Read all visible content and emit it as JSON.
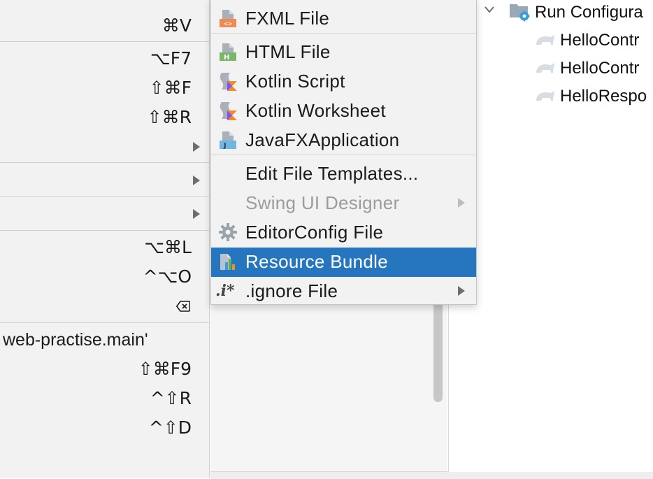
{
  "parent_menu": {
    "rows": [
      {
        "shortcut": "⌘V"
      },
      {
        "shortcut": "⌥F7"
      },
      {
        "shortcut": "⇧⌘F"
      },
      {
        "shortcut": "⇧⌘R"
      },
      {
        "shortcut": "",
        "has_submenu": true
      },
      {
        "shortcut": "",
        "has_submenu": true
      },
      {
        "shortcut": "",
        "has_submenu": true
      },
      {
        "shortcut": "⌥⌘L"
      },
      {
        "shortcut": "^⌥O"
      },
      {
        "shortcut": "",
        "icon": "clear-input-icon"
      },
      {
        "label": "web-practise.main'"
      },
      {
        "shortcut": "⇧⌘F9"
      },
      {
        "shortcut": "^⇧R"
      },
      {
        "shortcut": "^⇧D"
      }
    ]
  },
  "submenu": {
    "items": [
      {
        "label": "FXML File",
        "icon": "fxml-file-icon"
      },
      {
        "label": "HTML File",
        "icon": "html-file-icon"
      },
      {
        "label": "Kotlin Script",
        "icon": "kotlin-script-icon"
      },
      {
        "label": "Kotlin Worksheet",
        "icon": "kotlin-worksheet-icon"
      },
      {
        "label": "JavaFXApplication",
        "icon": "javafx-file-icon"
      },
      {
        "label": "Edit File Templates..."
      },
      {
        "label": "Swing UI Designer",
        "disabled": true,
        "has_submenu": true
      },
      {
        "label": "EditorConfig File",
        "icon": "gear-icon"
      },
      {
        "label": "Resource Bundle",
        "icon": "resource-bundle-icon",
        "selected": true
      },
      {
        "label": ".ignore File",
        "icon": "ignore-file-icon",
        "icon_text": ".i*",
        "has_submenu": true
      }
    ]
  },
  "project_tree": {
    "folder": {
      "label": "Run Configura",
      "icon": "run-config-folder-icon",
      "expanded": true
    },
    "children": [
      {
        "label": "HelloContr",
        "icon": "http-request-icon"
      },
      {
        "label": "HelloContr",
        "icon": "http-request-icon"
      },
      {
        "label": "HelloRespo",
        "icon": "http-request-icon"
      }
    ]
  },
  "colors": {
    "selection": "#2675bf",
    "menu_bg": "#f2f2f2",
    "disabled_text": "#9c9c9c"
  }
}
